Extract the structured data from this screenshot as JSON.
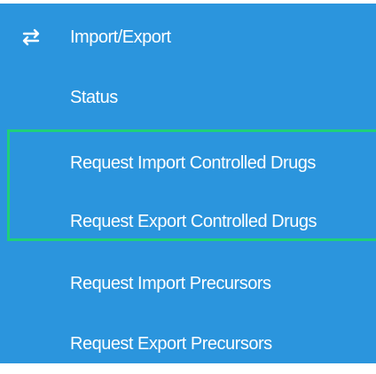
{
  "menu": {
    "header": {
      "icon": "exchange-arrows-icon",
      "label": "Import/Export"
    },
    "items": [
      {
        "label": "Status"
      },
      {
        "label": "Request Import Controlled Drugs"
      },
      {
        "label": "Request Export Controlled Drugs"
      },
      {
        "label": "Request Import Precursors"
      },
      {
        "label": "Request Export Precursors"
      }
    ]
  },
  "colors": {
    "menu_background": "#2b95dd",
    "text": "#ffffff",
    "highlight_border": "#1fd07a"
  }
}
